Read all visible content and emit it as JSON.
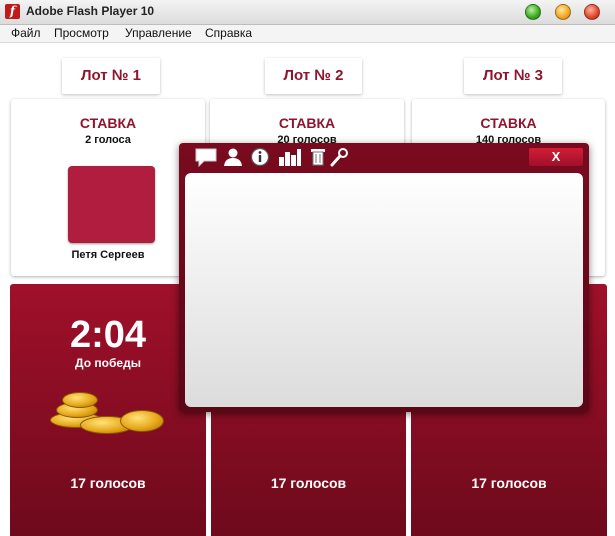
{
  "window": {
    "title": "Adobe Flash Player 10"
  },
  "menu": [
    "Файл",
    "Просмотр",
    "Управление",
    "Справка"
  ],
  "lots": [
    {
      "header": "Лот № 1",
      "bid_label": "СТАВКА",
      "bid_votes": "2 голоса",
      "bidder": "Петя Сергеев",
      "votes_total": "17 голосов"
    },
    {
      "header": "Лот № 2",
      "bid_label": "СТАВКА",
      "bid_votes": "20 голосов",
      "votes_total": "17 голосов"
    },
    {
      "header": "Лот № 3",
      "bid_label": "СТАВКА",
      "bid_votes": "140 голосов",
      "votes_total": "17 голосов"
    }
  ],
  "timer": {
    "value": "2:04",
    "label": "До победы"
  },
  "popup": {
    "close_label": "X",
    "toolbar_icons": [
      "chat-icon",
      "user-icon",
      "info-icon",
      "bar-chart-icon",
      "trash-icon",
      "wrench-icon"
    ]
  },
  "colors": {
    "accent": "#8e1530",
    "panel": "#a0102a",
    "avatar": "#b01d3e"
  }
}
